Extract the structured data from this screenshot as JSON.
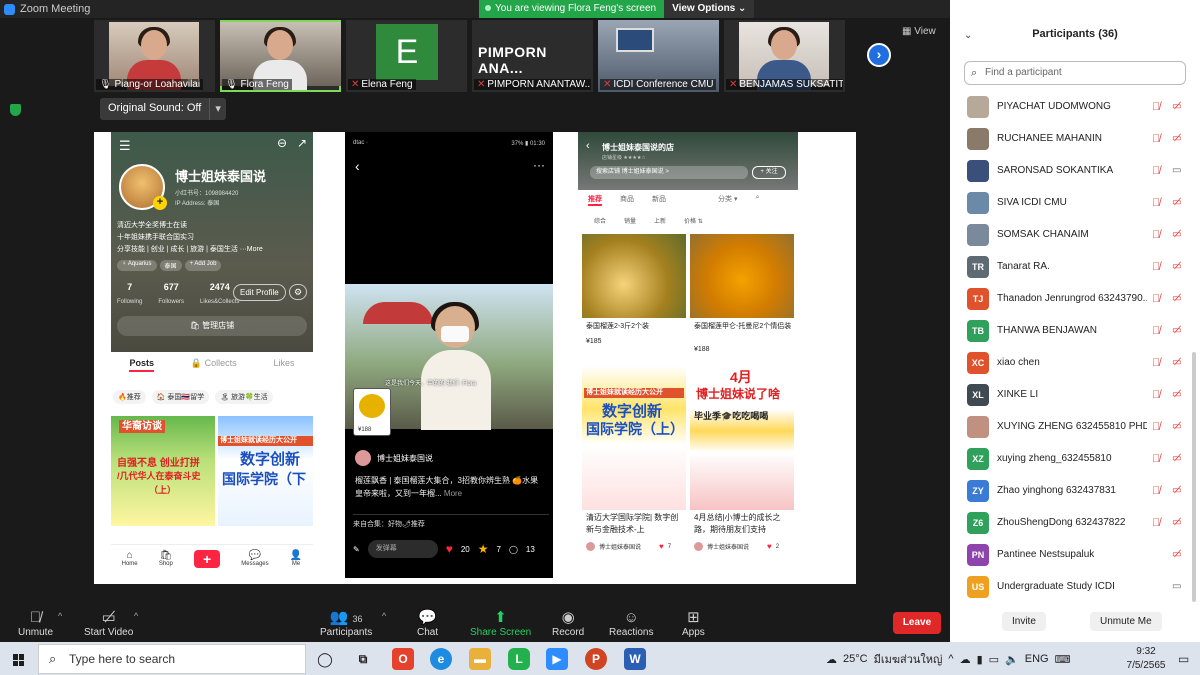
{
  "window": {
    "title": "Zoom Meeting"
  },
  "share_banner": {
    "message": "You are viewing Flora Feng's screen",
    "view_options": "View Options ⌄"
  },
  "window_controls": [
    "—",
    "▢",
    "✕"
  ],
  "view_label": "View",
  "original_sound": {
    "label": "Original Sound: Off",
    "arrow": "▾"
  },
  "thumbnails": [
    {
      "name": "Piang-or Loahavilai",
      "muted": false
    },
    {
      "name": "Flora Feng",
      "muted": false
    },
    {
      "name": "Elena Feng",
      "muted": true,
      "initial": "E"
    },
    {
      "name": "PIMPORN ANANTAW...",
      "muted": true,
      "display": "PIMPORN  ANA..."
    },
    {
      "name": "ICDI Conference CMU",
      "muted": true
    },
    {
      "name": "BENJAMAS SUKSATIT",
      "muted": true
    }
  ],
  "phone1": {
    "name": "博士姐妹泰国说",
    "id": "小红书号：1098984420",
    "address": "IP Address: 泰国",
    "bio": [
      "清迈大学全奖博士在读",
      "十年姐妹携手联合国实习",
      "分享技能 | 创业 | 成长 | 旅游 | 泰国生活 ···More"
    ],
    "tags": [
      "♀ Aquarius",
      "泰国",
      "+ Add Job"
    ],
    "stats": [
      {
        "value": "7",
        "label": "Following"
      },
      {
        "value": "677",
        "label": "Followers"
      },
      {
        "value": "2474",
        "label": "Likes&Collects"
      }
    ],
    "edit_profile": "Edit Profile",
    "manage": "🛍 管理店铺",
    "tabs": [
      "Posts",
      "🔒 Collects",
      "Likes"
    ],
    "subtabs": [
      "🔥推荐",
      "🏠 泰国🇹🇭留学",
      "🏝 旅游🍀生活"
    ],
    "card_a": {
      "line1": "华裔访谈",
      "line2": "自强不息 创业打拼",
      "line3": "/几代华人在泰奋斗史",
      "line4": "（上）"
    },
    "card_b": {
      "line1": "博士姐妹就读经历大公开",
      "line2": "数字创新",
      "line3": "国际学院（下"
    },
    "nav": [
      {
        "icon": "⌂",
        "label": "Home"
      },
      {
        "icon": "🛍",
        "label": "Shop"
      },
      {
        "icon": "+",
        "label": ""
      },
      {
        "icon": "💬",
        "label": "Messages"
      },
      {
        "icon": "👤",
        "label": "Me"
      }
    ]
  },
  "phone2": {
    "status_left": "dtac ·",
    "status_right": "37% ▮ 01:30",
    "subtitle": "这是我们今天，中的的 我们 ·Flora",
    "thumb_price": "¥188",
    "username": "博士姐妹泰国说",
    "caption": "榴莲飘香 | 泰国榴莲大集合，3招教你辨生熟 🍊水果皇帝来啦，又到一年榴...",
    "more": "More",
    "from": "来自合集：好物🌶推荐",
    "comment_placeholder": "发弹幕",
    "likes": "20",
    "collects": "7",
    "comments": "13"
  },
  "phone3": {
    "title": "博士姐妹泰国说的店",
    "subtitle": "店铺星级 ★★★★☆",
    "search": "搜索店铺   博士姐妹泰国说 >",
    "follow": "+ 关注",
    "tabs": [
      "推荐",
      "商品",
      "新品",
      "分类 ▾"
    ],
    "sort": [
      "综合",
      "销量",
      "上新",
      "价格 ⇅"
    ],
    "product1": {
      "caption": "泰国榴莲2-3斤2个装",
      "price": "¥185"
    },
    "product2": {
      "caption": "泰国榴莲甲仑-托曼尼2个情侣装",
      "price": "¥188"
    },
    "post1": {
      "banner": "博士姐妹就读经历大公开",
      "big1": "数字创新",
      "big2": "国际学院（上）",
      "caption": "清迈大学国际学院| 数字创新与金融技术-上",
      "author": "博士姐妹泰国说",
      "likes": "7"
    },
    "post2": {
      "big1": "4月",
      "big2": "博士姐妹说了啥",
      "line": "毕业季🎓吃吃喝喝",
      "caption": "4月总结|小博士的成长之路，期待朋友们支持",
      "author": "博士姐妹泰国说",
      "likes": "2"
    }
  },
  "toolbar": {
    "unmute": "Unmute",
    "start_video": "Start Video",
    "participants": "Participants",
    "participants_count": "36",
    "chat": "Chat",
    "share_screen": "Share Screen",
    "record": "Record",
    "reactions": "Reactions",
    "apps": "Apps",
    "leave": "Leave"
  },
  "panel": {
    "title": "Participants (36)",
    "search_placeholder": "Find a participant",
    "invite": "Invite",
    "unmute_me": "Unmute Me",
    "participants": [
      {
        "name": "PIYACHAT UDOMWONG",
        "initials": "",
        "color": "#b7a99a",
        "mic": "muted",
        "cam": "off"
      },
      {
        "name": "RUCHANEE MAHANIN",
        "initials": "",
        "color": "#8a7a6a",
        "mic": "muted",
        "cam": "off"
      },
      {
        "name": "SARONSAD SOKANTIKA",
        "initials": "",
        "color": "#3a4f7a",
        "mic": "muted",
        "cam": "on"
      },
      {
        "name": "SIVA ICDI CMU",
        "initials": "",
        "color": "#6a8aa8",
        "mic": "muted",
        "cam": "off"
      },
      {
        "name": "SOMSAK CHANAIM",
        "initials": "",
        "color": "#7a8a9a",
        "mic": "muted",
        "cam": "off"
      },
      {
        "name": "Tanarat RA.",
        "initials": "TR",
        "color": "#5f6b73",
        "mic": "muted",
        "cam": "off"
      },
      {
        "name": "Thanadon Jenrungrod 63243790...",
        "initials": "TJ",
        "color": "#e0522c",
        "mic": "muted",
        "cam": "off"
      },
      {
        "name": "THANWA BENJAWAN",
        "initials": "TB",
        "color": "#2fa15a",
        "mic": "muted",
        "cam": "off"
      },
      {
        "name": "xiao chen",
        "initials": "XC",
        "color": "#e0522c",
        "mic": "muted",
        "cam": "off"
      },
      {
        "name": "XINKE LI",
        "initials": "XL",
        "color": "#3f4a52",
        "mic": "muted",
        "cam": "off"
      },
      {
        "name": "XUYING ZHENG 632455810 PHD",
        "initials": "",
        "color": "#c09080",
        "mic": "muted",
        "cam": "off"
      },
      {
        "name": "xuying zheng_632455810",
        "initials": "XZ",
        "color": "#2fa15a",
        "mic": "muted",
        "cam": "off"
      },
      {
        "name": "Zhao yinghong 632437831",
        "initials": "ZY",
        "color": "#3a7bd5",
        "mic": "muted",
        "cam": "off"
      },
      {
        "name": "ZhouShengDong 632437822",
        "initials": "Z6",
        "color": "#2fa15a",
        "mic": "muted",
        "cam": "off"
      },
      {
        "name": "Pantinee Nestsupaluk",
        "initials": "PN",
        "color": "#8e44ad",
        "mic": "none",
        "cam": "off"
      },
      {
        "name": "Undergraduate Study ICDI",
        "initials": "US",
        "color": "#f0a020",
        "mic": "none",
        "cam": "on"
      }
    ]
  },
  "taskbar": {
    "search_placeholder": "Type here to search",
    "weather": "25°C",
    "weather_desc": "มีเมฆส่วนใหญ่",
    "lang": "ENG",
    "time": "9:32",
    "date": "7/5/2565"
  }
}
